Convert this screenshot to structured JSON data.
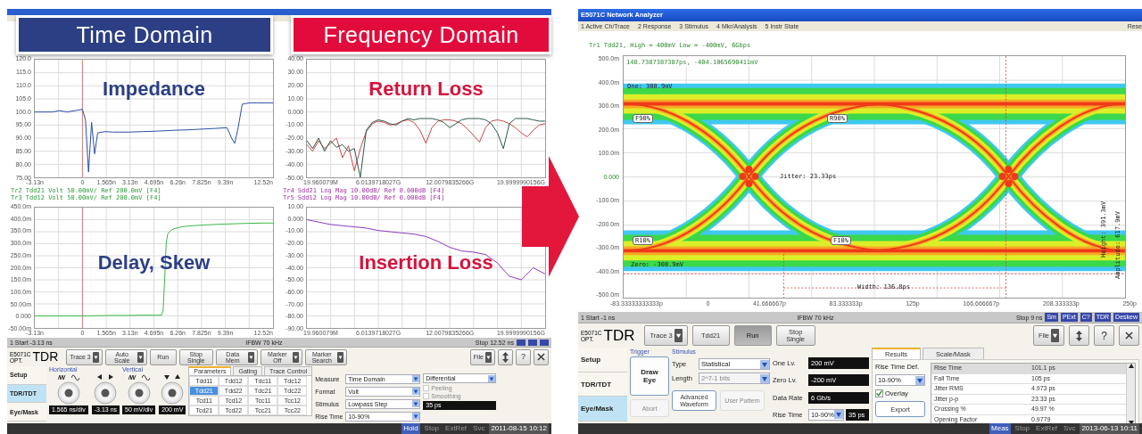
{
  "left_window": {
    "banners": [
      {
        "label": "Time Domain",
        "kind": "time"
      },
      {
        "label": "Frequency Domain",
        "kind": "frequency"
      }
    ],
    "charts": [
      {
        "kind": "impedance",
        "overlay": "Impedance",
        "legend": [
          "Tr2 Tdd21 Volt 50.00mV/ Ref 200.0mV [F4]",
          "Tr3 Tdd12 Volt 50.00mV/ Ref 200.0mV [F4]"
        ],
        "chart_data": {
          "type": "line",
          "grid": true,
          "x": [
            -3.13,
            -2.5,
            -2,
            -1.5,
            -1,
            -0.5,
            0,
            0.2,
            0.4,
            0.6,
            0.8,
            1,
            1.5,
            2,
            3,
            4,
            5,
            6,
            7,
            8,
            9,
            9.5,
            9.8,
            10,
            10.2,
            10.5,
            11,
            11.5,
            12,
            12.52
          ],
          "series": [
            {
              "color": "#2c4ea8",
              "values": [
                100,
                100,
                100,
                100.5,
                100,
                100.5,
                101,
                97,
                77,
                96,
                84,
                92,
                92.5,
                92.3,
                92.3,
                92.5,
                92.7,
                93,
                93.2,
                93.5,
                93.8,
                94,
                90,
                88,
                93,
                103,
                103.5,
                103.5,
                103.5,
                103.5
              ]
            }
          ],
          "ref_lines": [
            {
              "axis": "x",
              "value": 0,
              "color": "#d08080"
            }
          ],
          "xlim": [
            -3.13,
            12.52
          ],
          "ylim": [
            75,
            120
          ],
          "xticks": [
            {
              "value": -3.13,
              "label": "-3.13n"
            },
            {
              "value": 0,
              "label": "0"
            },
            {
              "value": 1.565,
              "label": "1.565n"
            },
            {
              "value": 3.13,
              "label": "3.13n"
            },
            {
              "value": 4.695,
              "label": "4.695n"
            },
            {
              "value": 6.26,
              "label": "6.26n"
            },
            {
              "value": 7.825,
              "label": "7.825n"
            },
            {
              "value": 9.39,
              "label": "9.39n"
            },
            {
              "value": 12.52,
              "label": "12.52n"
            }
          ],
          "yticks": [
            {
              "value": 120,
              "label": "120.0"
            },
            {
              "value": 115,
              "label": "115.0"
            },
            {
              "value": 110,
              "label": "110.0"
            },
            {
              "value": 105,
              "label": "105.0"
            },
            {
              "value": 100,
              "label": "100.0"
            },
            {
              "value": 95,
              "label": "95.00"
            },
            {
              "value": 90,
              "label": "90.00"
            },
            {
              "value": 85,
              "label": "85.00"
            },
            {
              "value": 80,
              "label": "80.00"
            },
            {
              "value": 75,
              "label": "75.00"
            }
          ]
        }
      },
      {
        "kind": "return_loss",
        "overlay": "Return Loss",
        "x_start_label": "19.960079M",
        "legend": [
          "Tr4 Sdd21 Log Mag 10.00dB/ Ref 0.000dB [F4]",
          "Tr5 Sdd12 Log Mag 10.00dB/ Ref 0.000dB [F4]"
        ],
        "chart_data": {
          "type": "line",
          "grid": true,
          "x": [
            0.02,
            0.5,
            1,
            1.5,
            2,
            2.5,
            3,
            3.5,
            4,
            4.5,
            5,
            5.5,
            6,
            6.5,
            7,
            7.5,
            8,
            8.5,
            9,
            9.5,
            10,
            10.5,
            11,
            11.5,
            12,
            12.5,
            13,
            13.5,
            14,
            14.5,
            15,
            15.5,
            16,
            16.5,
            17,
            17.5,
            18,
            18.5,
            19,
            19.5,
            19.99
          ],
          "series": [
            {
              "color": "#c84848",
              "values": [
                -25,
                -30,
                -22,
                -28,
                -24,
                -20,
                -35,
                -26,
                -45,
                -28,
                -15,
                -9,
                -7,
                -8,
                -10,
                -9,
                -7,
                -6,
                -8,
                -14,
                -24,
                -12,
                -7,
                -6,
                -6,
                -7,
                -9,
                -13,
                -18,
                -23,
                -12,
                -7,
                -6,
                -7,
                -9,
                -12,
                -16,
                -19,
                -14,
                -10,
                -9
              ]
            },
            {
              "color": "#2a5a4a",
              "values": [
                -22,
                -28,
                -20,
                -30,
                -22,
                -27,
                -25,
                -30,
                -28,
                -50,
                -14,
                -8,
                -6,
                -7,
                -9,
                -10,
                -7,
                -5,
                -6,
                -5,
                -5,
                -5,
                -6,
                -8,
                -12,
                -9,
                -6,
                -5,
                -5,
                -5,
                -6,
                -9,
                -16,
                -28,
                -9,
                -5,
                -5,
                -5,
                -6,
                -7,
                -7
              ]
            }
          ],
          "xlim": [
            0.019960079,
            19.9999990156
          ],
          "ylim": [
            -50,
            40
          ],
          "xticks": [
            {
              "value": 6.0139718027,
              "label": "6.0139718027G"
            },
            {
              "value": 12.0079835266,
              "label": "12.0079835266G"
            },
            {
              "value": 19.9999990156,
              "label": "19.9999990156G"
            }
          ],
          "yticks": [
            {
              "value": 40,
              "label": "40.00"
            },
            {
              "value": 30,
              "label": "30.00"
            },
            {
              "value": 20,
              "label": "20.00"
            },
            {
              "value": 10,
              "label": "10.00"
            },
            {
              "value": 0,
              "label": "0.000"
            },
            {
              "value": -10,
              "label": "-10.00"
            },
            {
              "value": -20,
              "label": "-20.00"
            },
            {
              "value": -30,
              "label": "-30.00"
            },
            {
              "value": -40,
              "label": "-40.00"
            },
            {
              "value": -50,
              "label": "-50.00"
            }
          ]
        }
      },
      {
        "kind": "step",
        "overlay": "Delay, Skew",
        "chart_data": {
          "type": "line",
          "grid": true,
          "x": [
            -3.13,
            -2,
            -1,
            0,
            1,
            2,
            3,
            4,
            5,
            5.2,
            5.3,
            5.4,
            5.5,
            5.6,
            5.8,
            6,
            6.5,
            7,
            8,
            9,
            10,
            11,
            12,
            12.52
          ],
          "series": [
            {
              "color": "#3cb84a",
              "values": [
                0,
                0,
                0,
                0,
                1,
                2,
                2,
                3,
                3,
                4,
                20,
                150,
                300,
                340,
                355,
                362,
                370,
                374,
                378,
                381,
                383,
                385,
                386,
                386
              ]
            }
          ],
          "ref_lines": [
            {
              "axis": "x",
              "value": 0,
              "color": "#d08080"
            }
          ],
          "xlim": [
            -3.13,
            12.52
          ],
          "ylim": [
            -50,
            450
          ],
          "xticks": [
            {
              "value": -3.13,
              "label": "-3.13n"
            },
            {
              "value": 0,
              "label": "0"
            },
            {
              "value": 1.565,
              "label": "1.565n"
            },
            {
              "value": 3.13,
              "label": "3.13n"
            },
            {
              "value": 4.695,
              "label": "4.695n"
            },
            {
              "value": 6.26,
              "label": "6.26n"
            },
            {
              "value": 7.825,
              "label": "7.825n"
            },
            {
              "value": 9.39,
              "label": "9.39n"
            },
            {
              "value": 12.52,
              "label": "12.52n"
            }
          ],
          "yticks": [
            {
              "value": 450,
              "label": "450.0m"
            },
            {
              "value": 400,
              "label": "400.0m"
            },
            {
              "value": 350,
              "label": "350.0m"
            },
            {
              "value": 300,
              "label": "300.0m"
            },
            {
              "value": 250,
              "label": "250.0m"
            },
            {
              "value": 200,
              "label": "200.0m"
            },
            {
              "value": 150,
              "label": "150.0m"
            },
            {
              "value": 100,
              "label": "100.0m"
            },
            {
              "value": 50,
              "label": "50.00m"
            },
            {
              "value": 0,
              "label": "0.000"
            },
            {
              "value": -50,
              "label": "-50.00m"
            }
          ]
        }
      },
      {
        "kind": "insertion_loss",
        "overlay": "Insertion Loss",
        "x_start_label": "19.960079M",
        "chart_data": {
          "type": "line",
          "grid": true,
          "x": [
            0.02,
            1,
            2,
            3,
            4,
            5,
            6,
            7,
            8,
            9,
            10,
            11,
            12,
            13,
            14,
            15,
            16,
            17,
            18,
            19,
            19.99
          ],
          "series": [
            {
              "color": "#8a3cc0",
              "values": [
                0,
                -2,
                -4,
                -5,
                -6,
                -7,
                -9,
                -10,
                -11,
                -12,
                -14,
                -18,
                -23,
                -26,
                -27,
                -29,
                -36,
                -47,
                -50,
                -40,
                -45
              ]
            }
          ],
          "xlim": [
            0.019960079,
            19.9999990156
          ],
          "ylim": [
            -90,
            10
          ],
          "xticks": [
            {
              "value": 6.0139718027,
              "label": "6.0139718027G"
            },
            {
              "value": 12.0079835266,
              "label": "12.0079835266G"
            },
            {
              "value": 19.9999990156,
              "label": "19.9999990156G"
            }
          ],
          "yticks": [
            {
              "value": 10,
              "label": "10.00"
            },
            {
              "value": 0,
              "label": "0.000"
            },
            {
              "value": -10,
              "label": "-10.00"
            },
            {
              "value": -20,
              "label": "-20.00"
            },
            {
              "value": -30,
              "label": "-30.00"
            },
            {
              "value": -40,
              "label": "-40.00"
            },
            {
              "value": -50,
              "label": "-50.00"
            },
            {
              "value": -60,
              "label": "-60.00"
            },
            {
              "value": -70,
              "label": "-70.00"
            },
            {
              "value": -80,
              "label": "-80.00"
            },
            {
              "value": -90,
              "label": "-90.00"
            }
          ]
        }
      }
    ],
    "status_bar": {
      "start": "1 Start -3.13 ns",
      "ifbw": "IFBW 70 kHz",
      "stop": "Stop 12.52 ns",
      "indicators": [
        {
          "kind": "indicator"
        },
        {
          "kind": "indicator"
        },
        {
          "kind": "indicator"
        }
      ]
    },
    "controls": {
      "logo": {
        "model": "E5071C",
        "option": "OPT.",
        "name": "TDR"
      },
      "toolbar": [
        {
          "label": "Trace 3",
          "dropdown": true,
          "pressed": false
        },
        {
          "label": "Auto Scale",
          "dropdown": true,
          "pressed": false
        },
        {
          "label": "Run",
          "dropdown": false,
          "pressed": false
        },
        {
          "label": "Stop Single",
          "dropdown": false,
          "pressed": false
        },
        {
          "label": "Data Mem",
          "dropdown": true,
          "pressed": false
        },
        {
          "label": "Marker Off",
          "dropdown": true,
          "pressed": false
        },
        {
          "label": "Marker Search",
          "dropdown": true,
          "pressed": false
        }
      ],
      "tools": [
        {
          "kind": "file",
          "label": "File"
        },
        {
          "kind": "updown"
        },
        {
          "kind": "help",
          "label": "?"
        },
        {
          "kind": "close"
        }
      ],
      "side_tabs": [
        {
          "label": "Setup",
          "selected": false
        },
        {
          "label": "TDR/TDT",
          "selected": true
        },
        {
          "label": "Eye/Mask",
          "selected": false
        }
      ],
      "groups": [
        {
          "label": "Horizontal",
          "kind": "horizontal",
          "fields": [
            "1.565 ns/div",
            "-3.13 ns"
          ]
        },
        {
          "label": "Vertical",
          "kind": "vertical",
          "fields": [
            "50 mV/div",
            "200 mV"
          ]
        }
      ],
      "param_tabs": [
        {
          "label": "Parameters",
          "selected": true
        },
        {
          "label": "Gating",
          "selected": false
        },
        {
          "label": "Trace Control",
          "selected": false
        }
      ],
      "param_grid": [
        [
          {
            "label": "Tdd11",
            "selected": false
          },
          {
            "label": "Tdd12",
            "selected": false
          },
          {
            "label": "Tdc11",
            "selected": false
          },
          {
            "label": "Tdc12",
            "selected": false
          }
        ],
        [
          {
            "label": "Tdd21",
            "selected": true
          },
          {
            "label": "Tdd22",
            "selected": false
          },
          {
            "label": "Tdc21",
            "selected": false
          },
          {
            "label": "Tdc22",
            "selected": false
          }
        ],
        [
          {
            "label": "Tcd11",
            "selected": false
          },
          {
            "label": "Tcd12",
            "selected": false
          },
          {
            "label": "Tcc11",
            "selected": false
          },
          {
            "label": "Tcc12",
            "selected": false
          }
        ],
        [
          {
            "label": "Tcd21",
            "selected": false
          },
          {
            "label": "Tcd22",
            "selected": false
          },
          {
            "label": "Tcc21",
            "selected": false
          },
          {
            "label": "Tcc22",
            "selected": false
          }
        ]
      ],
      "settings": [
        {
          "label": "Measure",
          "value": "Time Domain"
        },
        {
          "label": "Format",
          "value": "Volt"
        },
        {
          "label": "Stimulus",
          "value": "Lowpass Step"
        },
        {
          "label": "Rise Time",
          "value": "10-90%"
        }
      ],
      "mode": "Differential",
      "checks": [
        {
          "label": "Peeling",
          "checked": false,
          "disabled": true
        },
        {
          "label": "Smoothing",
          "checked": false,
          "disabled": true
        }
      ],
      "rise_time_value": "35 ps"
    },
    "bottom_bar": {
      "items": [
        {
          "label": "Hold",
          "highlighted": true,
          "disabled": false
        },
        {
          "label": "Stop",
          "highlighted": false,
          "disabled": true
        },
        {
          "label": "ExtRef",
          "highlighted": false,
          "disabled": true
        },
        {
          "label": "Svc",
          "highlighted": false,
          "disabled": true
        }
      ],
      "clock": "2011-08-15 10:12"
    }
  },
  "right_window": {
    "title": "E5071C Network Analyzer",
    "menu": [
      "1 Active Ch/Trace",
      "2 Response",
      "3 Stimulus",
      "4 Mkr/Analysis",
      "5 Instr State",
      "Rese"
    ],
    "trace_header": "Tr1 Tdd21, High = 400mV Low = -400mV, 6Gbps",
    "yticks": [
      {
        "label": "500.0m",
        "reference": false
      },
      {
        "label": "400.0m",
        "reference": false
      },
      {
        "label": "300.0m",
        "reference": false
      },
      {
        "label": "200.0m",
        "reference": false
      },
      {
        "label": "100.0m",
        "reference": false
      },
      {
        "label": "0.000",
        "reference": true
      },
      {
        "label": "-100.0m",
        "reference": false
      },
      {
        "label": "-200.0m",
        "reference": false
      },
      {
        "label": "-300.0m",
        "reference": false
      },
      {
        "label": "-400.0m",
        "reference": false
      },
      {
        "label": "-500.0m",
        "reference": false
      }
    ],
    "xticks": [
      "-83.33333333333p",
      "0",
      "41.666667p",
      "83.333333p",
      "125p",
      "166.666667p",
      "208.333333p",
      "250p"
    ],
    "annotations": [
      {
        "kind": "cursor",
        "text": "148.7387387387ps, -404.1065690411mV"
      },
      {
        "kind": "one",
        "text": "One: 308.9mV"
      },
      {
        "kind": "f90",
        "text": "F90%"
      },
      {
        "kind": "r90",
        "text": "R90%"
      },
      {
        "kind": "jitter",
        "text": "Jitter: 23.33ps"
      },
      {
        "kind": "height",
        "text": "Height: 391.3mV"
      },
      {
        "kind": "amplitude",
        "text": "Amplitude: 617.9mV"
      },
      {
        "kind": "r10",
        "text": "R10%"
      },
      {
        "kind": "f10",
        "text": "F10%"
      },
      {
        "kind": "zero",
        "text": "Zero: -308.9mV"
      },
      {
        "kind": "width",
        "text": "Width: 136.8ps"
      }
    ],
    "status_bar": {
      "start": "1 Start -1 ns",
      "ifbw": "IFBW 70 kHz",
      "stop": "Stop 9 ns",
      "indicators": [
        {
          "kind": "label",
          "label": "Sm"
        },
        {
          "kind": "label",
          "label": "PExt"
        },
        {
          "kind": "label",
          "label": "C?"
        },
        {
          "kind": "label",
          "label": "TDR"
        },
        {
          "kind": "label",
          "label": "Deskew"
        }
      ]
    },
    "controls": {
      "logo": {
        "model": "E5071C",
        "option": "OPT.",
        "name": "TDR"
      },
      "toolbar": [
        {
          "label": "Trace 3",
          "dropdown": true,
          "pressed": false
        },
        {
          "label": "Tdd21",
          "dropdown": false,
          "pressed": false
        },
        {
          "label": "Run",
          "dropdown": false,
          "pressed": true
        },
        {
          "label": "Stop Single",
          "dropdown": false,
          "pressed": false
        }
      ],
      "tools": [
        {
          "kind": "file",
          "label": "File"
        },
        {
          "kind": "updown"
        },
        {
          "kind": "help",
          "label": "?"
        },
        {
          "kind": "close"
        }
      ],
      "side_tabs": [
        {
          "label": "Setup",
          "selected": false
        },
        {
          "label": "TDR/TDT",
          "selected": false
        },
        {
          "label": "Eye/Mask",
          "selected": true
        }
      ],
      "trigger": {
        "label": "Trigger",
        "buttons": [
          {
            "label": "Draw Eye",
            "disabled": false
          },
          {
            "label": "Abort",
            "disabled": true
          }
        ]
      },
      "stimulus": {
        "label": "Stimulus",
        "selects": [
          {
            "label": "Type",
            "value": "Statistical",
            "disabled": false
          },
          {
            "label": "Length",
            "value": "2^7-1 bits",
            "disabled": true
          }
        ],
        "buttons": [
          {
            "label": "Advanced Waveform",
            "disabled": false
          },
          {
            "label": "User Pattern",
            "disabled": true
          }
        ],
        "levels": [
          {
            "label": "One Lv.",
            "value": "200 mV"
          },
          {
            "label": "Zero Lv.",
            "value": "-200 mV"
          },
          {
            "label": "Data Rate",
            "value": "6 Gb/s"
          }
        ],
        "rise_time": {
          "label": "Rise Time",
          "value": "10-90%",
          "extra": "35 ps"
        }
      },
      "result_tabs": [
        {
          "label": "Results",
          "selected": true
        },
        {
          "label": "Scale/Mask",
          "selected": false
        }
      ],
      "rise_time_def": {
        "label": "Rise Time Def.",
        "value": "10-90%"
      },
      "overlay": {
        "label": "Overlay",
        "checked": true
      },
      "export": "Export",
      "results": [
        {
          "name": "Rise Time",
          "value": "101.1 ps",
          "selected": true
        },
        {
          "name": "Fall Time",
          "value": "105 ps",
          "selected": false
        },
        {
          "name": "Jitter RMS",
          "value": "4.973 ps",
          "selected": false
        },
        {
          "name": "Jitter p-p",
          "value": "23.33 ps",
          "selected": false
        },
        {
          "name": "Crossing %",
          "value": "49.97 %",
          "selected": false
        },
        {
          "name": "Opening Factor",
          "value": "0.9779",
          "selected": false
        }
      ]
    },
    "bottom_bar": {
      "items": [
        {
          "label": "Meas",
          "highlighted": true,
          "disabled": false
        },
        {
          "label": "Stop",
          "highlighted": false,
          "disabled": true
        },
        {
          "label": "ExtRef",
          "highlighted": false,
          "disabled": true
        },
        {
          "label": "Svc",
          "highlighted": false,
          "disabled": true
        }
      ],
      "clock": "2013-06-13 10:11"
    }
  }
}
